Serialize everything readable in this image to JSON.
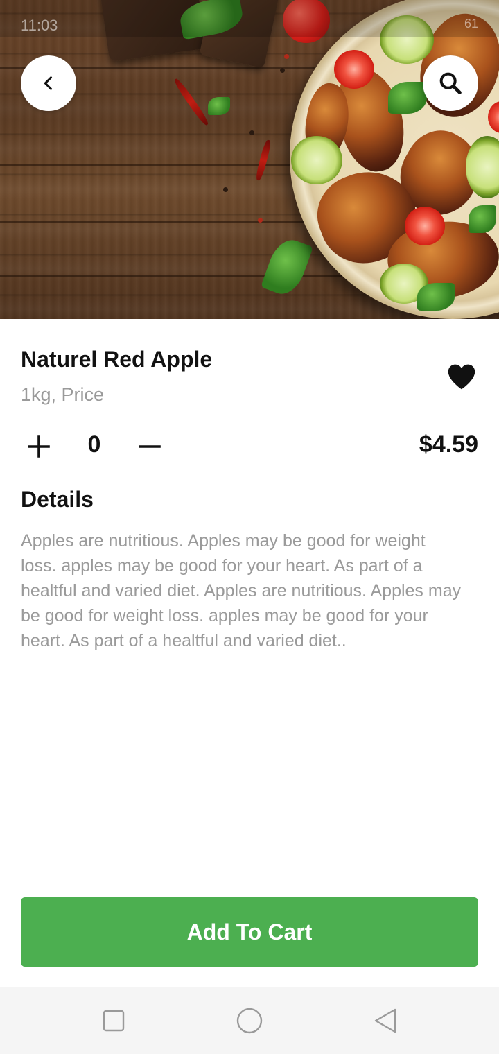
{
  "status_bar": {
    "time": "11:03",
    "battery": "61"
  },
  "product": {
    "name": "Naturel Red Apple",
    "unit_price_label": "1kg, Price",
    "price": "$4.59",
    "quantity": "0",
    "favorite": true
  },
  "details": {
    "heading": "Details",
    "text": "Apples are nutritious. Apples may be good for weight loss. apples may be good for your heart. As part of a healtful and varied diet. Apples are nutritious. Apples may be good for weight loss. apples may be good for your heart. As part of a healtful and varied diet.."
  },
  "actions": {
    "add_to_cart": "Add To Cart"
  },
  "icons": {
    "back": "chevron-left-icon",
    "search": "search-icon",
    "favorite": "heart-icon",
    "increase": "plus-icon",
    "decrease": "minus-icon",
    "nav_recent": "square-icon",
    "nav_home": "circle-icon",
    "nav_back": "triangle-back-icon"
  },
  "colors": {
    "accent": "#4caf50",
    "muted_text": "#9a9a9a",
    "primary_text": "#111111"
  }
}
